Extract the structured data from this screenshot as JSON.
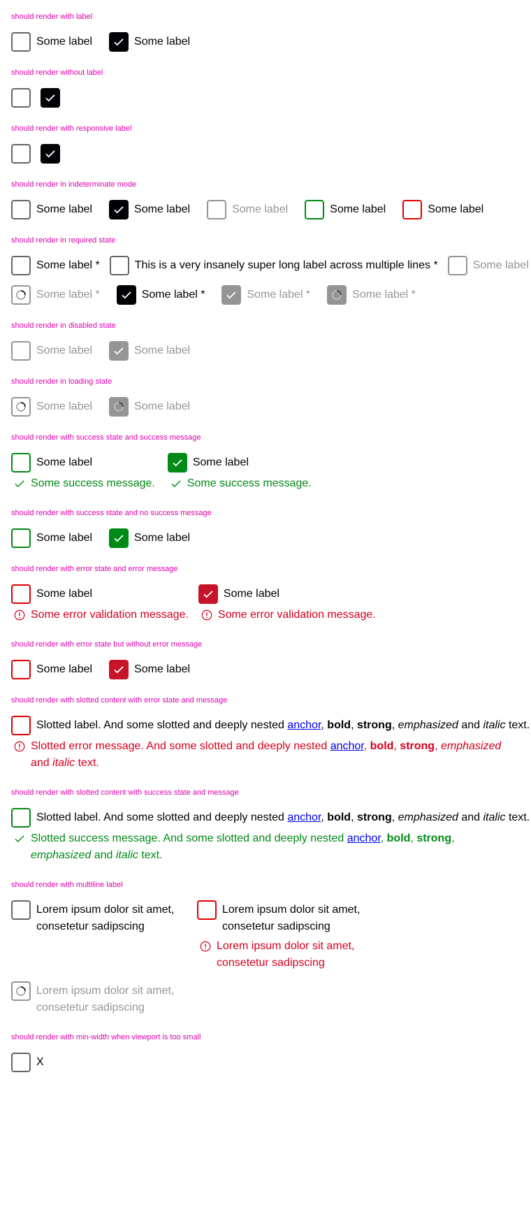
{
  "colors": {
    "heading": "#de00ad",
    "border": "#626669",
    "checked": "#010205",
    "disabled": "#949595",
    "success": "#018a16",
    "error": "#d5001c"
  },
  "sections": {
    "s1": {
      "title": "should render with label",
      "label": "Some label"
    },
    "s2": {
      "title": "should render without label"
    },
    "s3": {
      "title": "should render with responsive label"
    },
    "s4": {
      "title": "should render in indeterminate mode",
      "label": "Some label"
    },
    "s5": {
      "title": "should render in required state",
      "label_req": "Some label *",
      "long_label": "This is a very insanely super long label across multiple lines *"
    },
    "s6": {
      "title": "should render in disabled state",
      "label": "Some label"
    },
    "s7": {
      "title": "should render in loading state",
      "label": "Some label"
    },
    "s8": {
      "title": "should render with success state and success message",
      "label": "Some label",
      "message": "Some success message."
    },
    "s9": {
      "title": "should render with success state and no success message",
      "label": "Some label"
    },
    "s10": {
      "title": "should render with error state and error message",
      "label": "Some label",
      "message": "Some error validation message."
    },
    "s11": {
      "title": "should render with error state but without error message",
      "label": "Some label"
    },
    "s12": {
      "title": "should render with slotted content with error state and message",
      "label_a": "Slotted label. And some slotted and deeply nested ",
      "msg_a": "Slotted error message. And some slotted and deeply nested "
    },
    "s13": {
      "title": "should render with slotted content with success state and message",
      "label_a": "Slotted label. And some slotted and deeply nested ",
      "msg_a": "Slotted success message. And some slotted and deeply nested "
    },
    "s14": {
      "title": "should render with multiline label",
      "label": "Lorem ipsum dolor sit amet, consetetur sadipscing"
    },
    "s15": {
      "title": "should render with min-width when viewport is too small",
      "label": "X"
    }
  },
  "rich": {
    "anchor": "anchor",
    "comma": ", ",
    "bold": "bold",
    "strong": "strong",
    "emphasized": "emphasized",
    "and": " and ",
    "italic": "italic",
    "tail": " text."
  }
}
